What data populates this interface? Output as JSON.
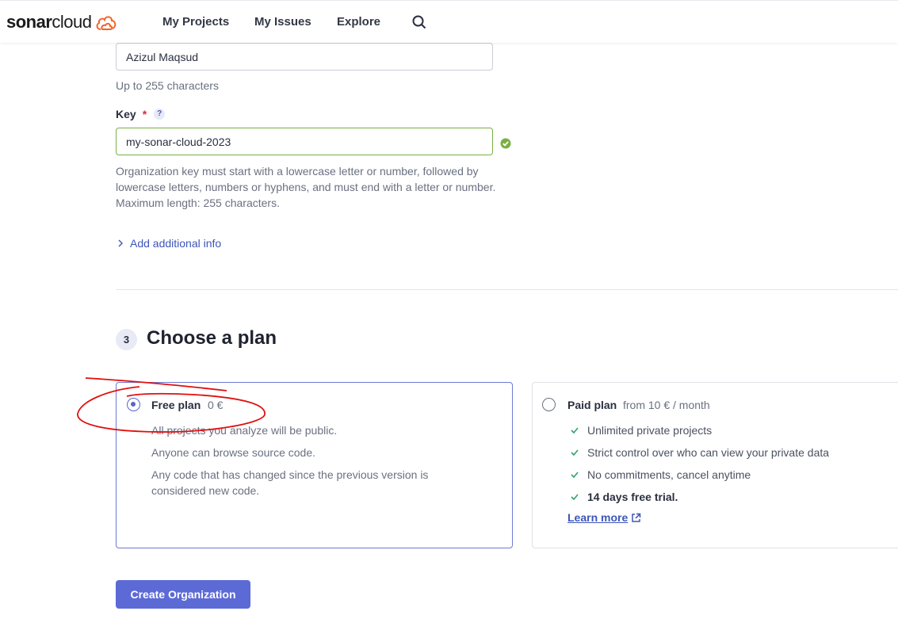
{
  "header": {
    "logo_part1": "sonar",
    "logo_part2": "cloud",
    "nav": {
      "my_projects": "My Projects",
      "my_issues": "My Issues",
      "explore": "Explore"
    },
    "search_icon": "search-icon"
  },
  "form": {
    "name_value": "Azizul Maqsud",
    "name_help": "Up to 255 characters",
    "key_label": "Key",
    "key_required": "*",
    "key_help_icon": "?",
    "key_value": "my-sonar-cloud-2023",
    "key_help": "Organization key must start with a lowercase letter or number, followed by lowercase letters, numbers or hyphens, and must end with a letter or number. Maximum length: 255 characters.",
    "add_info": "Add additional info"
  },
  "plan_section": {
    "step_number": "3",
    "title": "Choose a plan",
    "free": {
      "name": "Free plan",
      "price": "0 €",
      "selected": true,
      "lines": [
        "All projects you analyze will be public.",
        "Anyone can browse source code.",
        "Any code that has changed since the previous version is considered new code."
      ]
    },
    "paid": {
      "name": "Paid plan",
      "price": "from 10 € / month",
      "selected": false,
      "features": [
        "Unlimited private projects",
        "Strict control over who can view your private data",
        "No commitments, cancel anytime",
        "14 days free trial."
      ],
      "learn_more": "Learn more"
    }
  },
  "submit": {
    "label": "Create Organization"
  },
  "colors": {
    "accent": "#5c6ad6",
    "link": "#3c56b8",
    "success": "#79b043",
    "required": "#d02f3a",
    "annotation": "#e01010"
  }
}
